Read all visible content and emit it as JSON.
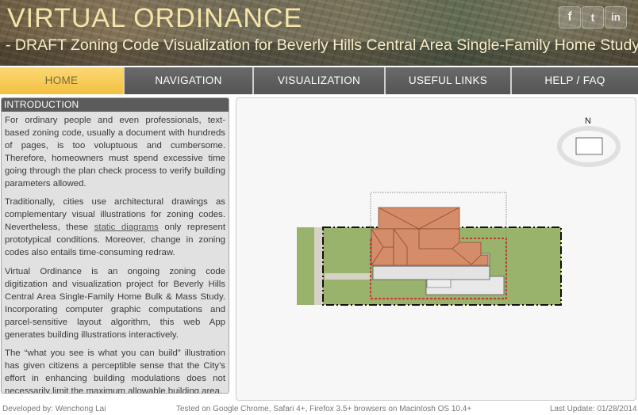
{
  "header": {
    "title": "VIRTUAL ORDINANCE",
    "subtitle": "- DRAFT Zoning Code Visualization for Beverly Hills Central Area Single-Family Home Study",
    "social": [
      {
        "icon": "facebook-icon",
        "glyph": "f"
      },
      {
        "icon": "twitter-icon",
        "glyph": "t"
      },
      {
        "icon": "linkedin-icon",
        "glyph": "in"
      }
    ]
  },
  "nav": {
    "items": [
      {
        "label": "HOME",
        "active": true
      },
      {
        "label": "NAVIGATION",
        "active": false
      },
      {
        "label": "VISUALIZATION",
        "active": false
      },
      {
        "label": "USEFUL LINKS",
        "active": false
      },
      {
        "label": "HELP / FAQ",
        "active": false
      }
    ]
  },
  "intro": {
    "heading": "INTRODUCTION",
    "p1": "For ordinary people and even professionals, text-based zoning code, usually a document with hundreds of pages, is too voluptuous and cumbersome. Therefore, homeowners must spend excessive time going through the plan check process to verify building parameters allowed.",
    "p2_before": "Traditionally, cities use architectural drawings as complementary visual illustrations for zoning codes. Nevertheless, these ",
    "p2_link": "static diagrams",
    "p2_after": " only represent prototypical conditions. Moreover, change in zoning codes also entails time-consuming redraw.",
    "p3": "Virtual Ordinance is an ongoing zoning code digitization and visualization project for Beverly Hills Central Area Single-Family Home Bulk & Mass Study. Incorporating computer graphic computations and parcel-sensitive layout algorithm, this web App generates building illustrations interactively.",
    "p4": "The “what you see is what you can build” illustration has given citizens a perceptible sense that the City’s effort in enhancing building modulations does not necessarily limit the maximum allowable building area."
  },
  "viz": {
    "north_label": "N",
    "colors": {
      "lot": "#99b36c",
      "roof": "#d58c69",
      "roof_edge": "#8a4a30",
      "building": "#e3e3e3",
      "setback": "#d11818",
      "parkway": "#d6d2c6"
    }
  },
  "footer": {
    "developer": "Developed by: Wenchong Lai",
    "tested": "Tested on Google Chrome, Safari 4+, Firefox 3.5+ browsers on Macintosh OS 10.4+",
    "updated": "Last Update: 01/28/2014"
  },
  "colors": {
    "nav_active": "#f5c852",
    "nav_bg": "#5f5f5f",
    "title": "#f5e4a8"
  }
}
